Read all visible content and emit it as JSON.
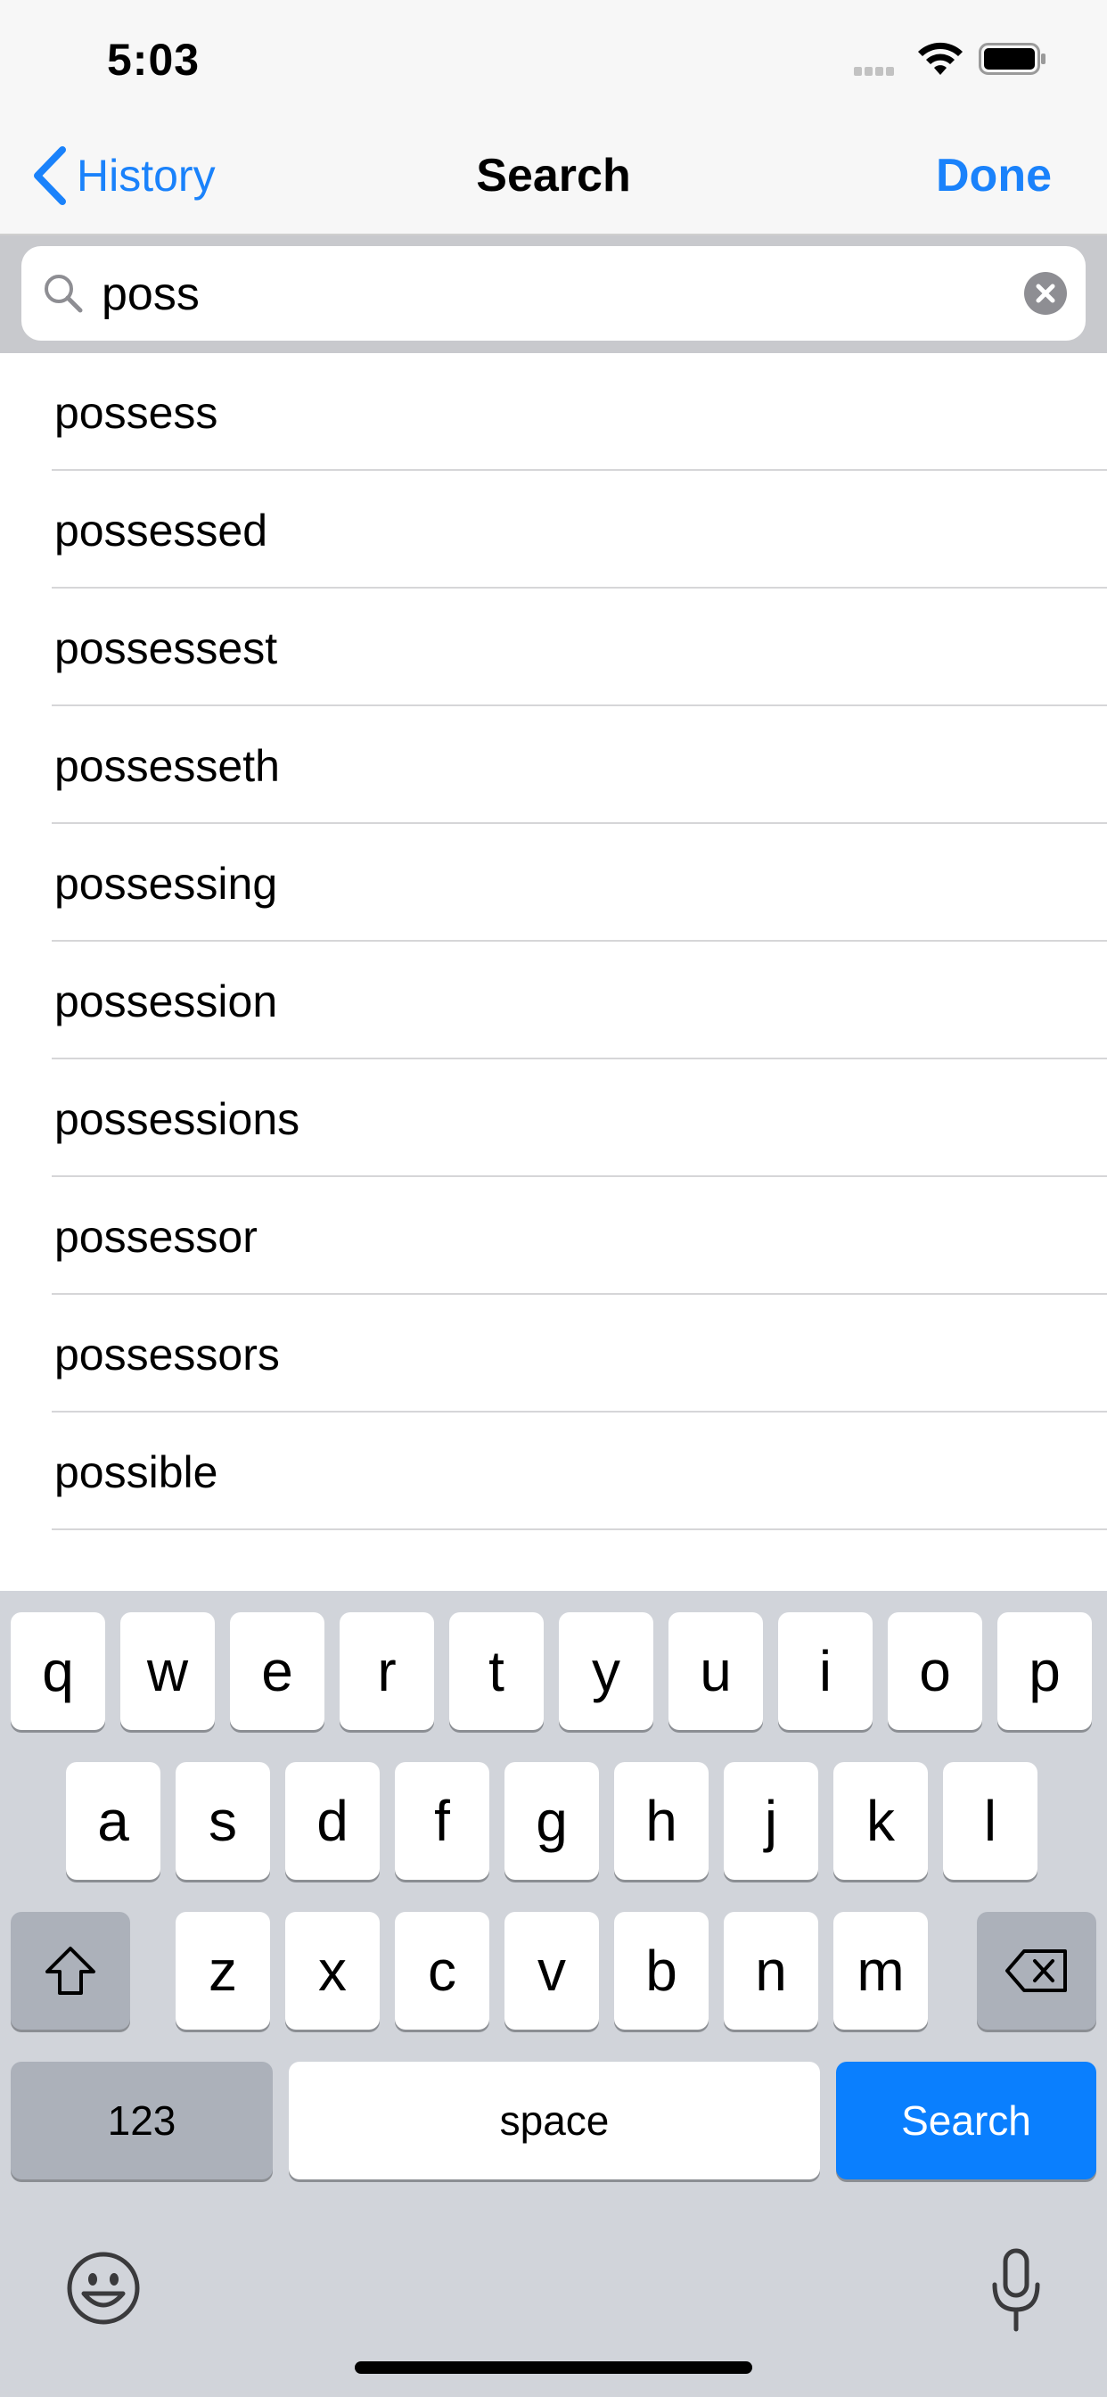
{
  "status": {
    "time": "5:03"
  },
  "nav": {
    "back_label": "History",
    "title": "Search",
    "done_label": "Done"
  },
  "search": {
    "value": "poss"
  },
  "results": [
    "possess",
    "possessed",
    "possessest",
    "possesseth",
    "possessing",
    "possession",
    "possessions",
    "possessor",
    "possessors",
    "possible"
  ],
  "keyboard": {
    "row1": [
      "q",
      "w",
      "e",
      "r",
      "t",
      "y",
      "u",
      "i",
      "o",
      "p"
    ],
    "row2": [
      "a",
      "s",
      "d",
      "f",
      "g",
      "h",
      "j",
      "k",
      "l"
    ],
    "row3": [
      "z",
      "x",
      "c",
      "v",
      "b",
      "n",
      "m"
    ],
    "numbers_label": "123",
    "space_label": "space",
    "search_label": "Search"
  },
  "colors": {
    "accent": "#1a82fb",
    "search_key": "#0a7ffe"
  }
}
